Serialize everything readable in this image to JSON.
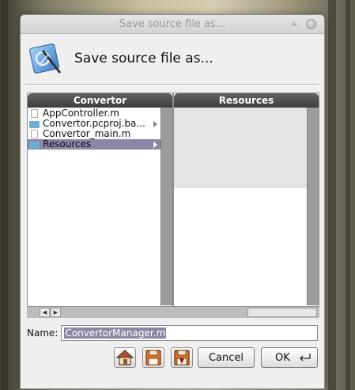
{
  "window": {
    "title": "Save source file as...",
    "header_title": "Save source file as..."
  },
  "browser": {
    "columns": [
      {
        "title": "Convertor",
        "items": [
          {
            "label": "AppController.m",
            "icon": "document-icon",
            "has_children": false,
            "selected": false
          },
          {
            "label": "Convertor.pcproj.ba...",
            "icon": "folder-icon",
            "has_children": true,
            "selected": false
          },
          {
            "label": "Convertor_main.m",
            "icon": "document-icon",
            "has_children": false,
            "selected": false
          },
          {
            "label": "Resources",
            "icon": "folder-icon",
            "has_children": true,
            "selected": true
          }
        ]
      },
      {
        "title": "Resources",
        "items": []
      }
    ]
  },
  "name_field": {
    "label": "Name:",
    "value": "ConvertorManager.m"
  },
  "buttons": {
    "home_icon": "home-icon",
    "save_icon": "floppy-disk-icon",
    "save_down_icon": "floppy-disk-down-icon",
    "cancel_label": "Cancel",
    "ok_label": "OK"
  },
  "colors": {
    "selection": "#8c86a6",
    "column_header": "#4a4a4a",
    "folder": "#6aaed6"
  }
}
